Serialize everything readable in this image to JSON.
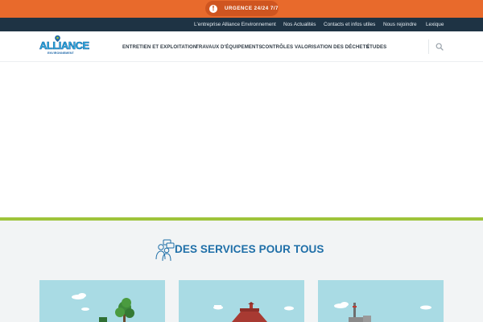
{
  "urgency": {
    "label": "URGENCE 24/24 7/7",
    "icon": "exclamation-icon"
  },
  "top_nav": {
    "links": [
      "L'entreprise Alliance Environnement",
      "Nos Actualités",
      "Contacts et infos utiles",
      "Nous rejoindre",
      "Lexique"
    ]
  },
  "header": {
    "logo_word": "ALLIANCE",
    "logo_sub": "ENVIRONNEMENT",
    "nav": [
      "ENTRETIEN ET EXPLOITATION",
      "TRAVAUX D'ÉQUIPEMENTS",
      "CONTRÔLES",
      "VALORISATION DES DÉCHETS",
      "ÉTUDES"
    ],
    "search_icon": "search-icon"
  },
  "services": {
    "title": "DES SERVICES POUR TOUS",
    "icon": "people-chat-icon"
  },
  "colors": {
    "urgency_bg": "#e86a2c",
    "top_nav_bg": "#1e3344",
    "accent_green": "#9ec43a",
    "title_blue": "#1f6fa8"
  }
}
